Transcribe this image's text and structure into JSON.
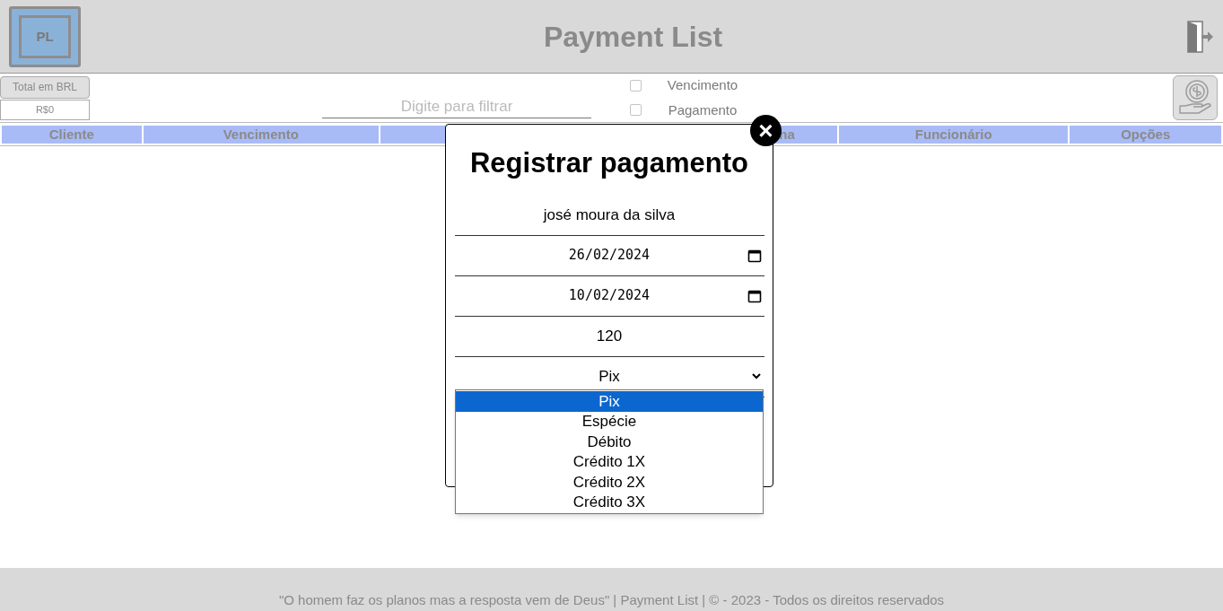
{
  "header": {
    "logo_text": "PL",
    "title": "Payment List"
  },
  "toolbar": {
    "total_button": "Total em BRL",
    "total_value": "R$0",
    "filter": {
      "placeholder": "Digite para filtrar"
    },
    "checkboxes": [
      {
        "label": "Vencimento",
        "checked": false
      },
      {
        "label": "Pagamento",
        "checked": false
      }
    ]
  },
  "table": {
    "columns": [
      {
        "label": "Cliente"
      },
      {
        "label": "Vencimento"
      },
      {},
      {
        "label": "na"
      },
      {
        "label": "Funcionário"
      },
      {
        "label": "Opções"
      }
    ]
  },
  "modal": {
    "title": "Registrar pagamento",
    "close": "×",
    "fields": [
      {
        "kind": "text",
        "value": "josé moura da silva"
      },
      {
        "kind": "date",
        "value": "26/02/2024"
      },
      {
        "kind": "date",
        "value": "10/02/2024"
      },
      {
        "kind": "text",
        "value": "120"
      },
      {
        "kind": "select",
        "value": "Pix"
      }
    ],
    "dropdown": [
      {
        "label": "Pix",
        "selected": true
      },
      {
        "label": "Espécie",
        "selected": false
      },
      {
        "label": "Débito",
        "selected": false
      },
      {
        "label": "Crédito 1X",
        "selected": false
      },
      {
        "label": "Crédito 2X",
        "selected": false
      },
      {
        "label": "Crédito 3X",
        "selected": false
      }
    ]
  },
  "footer": "\"O homem faz os planos mas a resposta vem de Deus\" | Payment List | © - 2023 - Todos os direitos reservados"
}
